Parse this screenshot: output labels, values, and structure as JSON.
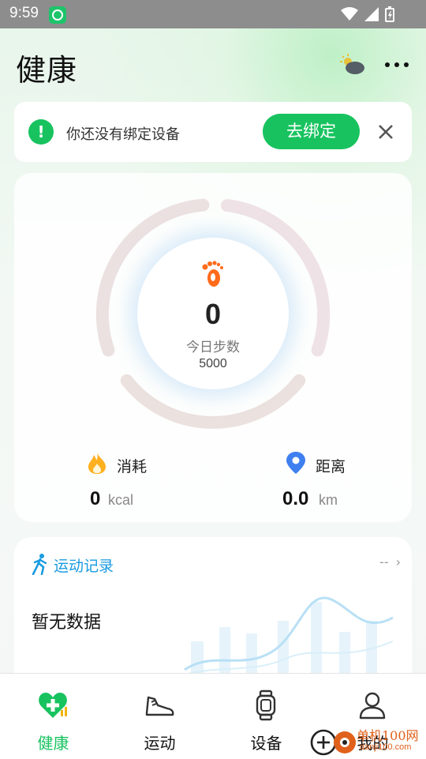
{
  "status_bar": {
    "time": "9:59"
  },
  "header": {
    "title": "健康",
    "weather_icon": "weather-cloud-sun-icon",
    "more_icon": "more-dots-icon"
  },
  "bind_banner": {
    "message": "你还没有绑定设备",
    "button_label": "去绑定",
    "alert_icon": "exclamation-icon",
    "close_icon": "close-icon"
  },
  "steps": {
    "value": "0",
    "label": "今日步数",
    "goal": "5000",
    "progress": 0,
    "accent": "#ff6b1a"
  },
  "stats": [
    {
      "label": "消耗",
      "value": "0",
      "unit": "kcal",
      "icon": "flame-icon",
      "color": "#ffb020"
    },
    {
      "label": "距离",
      "value": "0.0",
      "unit": "km",
      "icon": "location-pin-icon",
      "color": "#3f7ff0"
    }
  ],
  "records": {
    "title": "运动记录",
    "more": "--",
    "empty_text": "暂无数据"
  },
  "nav": [
    {
      "label": "健康",
      "icon": "heart-plus-icon",
      "active": true
    },
    {
      "label": "运动",
      "icon": "sneaker-icon",
      "active": false
    },
    {
      "label": "设备",
      "icon": "watch-icon",
      "active": false
    },
    {
      "label": "我的",
      "icon": "user-icon",
      "active": false
    }
  ],
  "watermark": {
    "text": "单机100网",
    "sub": "danji100.com"
  },
  "colors": {
    "primary": "#18c35f",
    "link": "#1a9be0"
  }
}
